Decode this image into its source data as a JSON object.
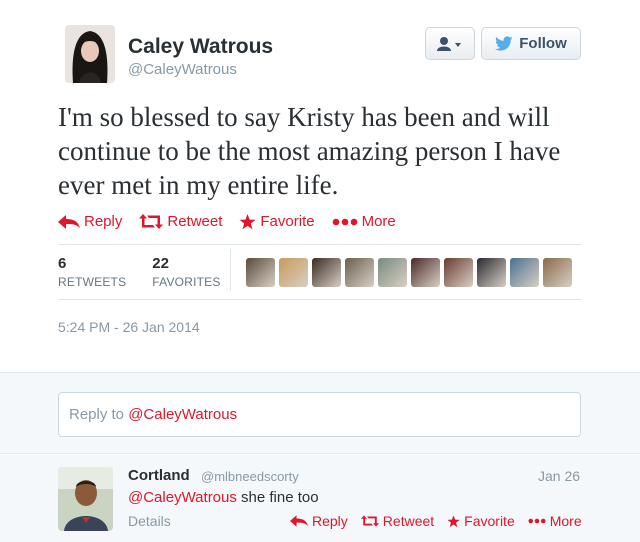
{
  "tweet": {
    "author_name": "Caley Watrous",
    "author_handle": "@CaleyWatrous",
    "text": "I'm so blessed to say Kristy has been and will continue to be the most amazing person I have ever met in my entire life.",
    "timestamp": "5:24 PM - 26 Jan 2014",
    "follow_label": "Follow",
    "actions": {
      "reply": "Reply",
      "retweet": "Retweet",
      "favorite": "Favorite",
      "more": "More"
    },
    "stats": {
      "retweets_count": "6",
      "retweets_label": "RETWEETS",
      "favorites_count": "22",
      "favorites_label": "FAVORITES"
    },
    "favoriters": [
      {
        "color": "#5a4a3a"
      },
      {
        "color": "#c89a5a"
      },
      {
        "color": "#3a2a22"
      },
      {
        "color": "#6a6050"
      },
      {
        "color": "#7a8a80"
      },
      {
        "color": "#4a2a2a"
      },
      {
        "color": "#6a3a30"
      },
      {
        "color": "#2a2a30"
      },
      {
        "color": "#4a7090"
      },
      {
        "color": "#8a6a4a"
      }
    ]
  },
  "reply_box": {
    "prefix": "Reply to ",
    "mention": "@CaleyWatrous"
  },
  "reply": {
    "author_name": "Cortland",
    "author_handle": "@mlbneedscorty",
    "date": "Jan 26",
    "mention": "@CaleyWatrous",
    "text": " she fine too",
    "details_label": "Details",
    "actions": {
      "reply": "Reply",
      "retweet": "Retweet",
      "favorite": "Favorite",
      "more": "More"
    }
  },
  "colors": {
    "accent": "#e0162b",
    "muted": "#8899a6",
    "follow_bird": "#55acee"
  }
}
